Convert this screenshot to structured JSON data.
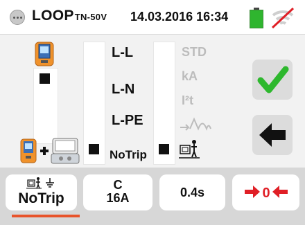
{
  "header": {
    "title": "LOOP",
    "title_sub": "TN-50V",
    "datetime": "14.03.2016 16:34",
    "battery_color": "#2fb52f",
    "wifi_disabled_color": "#e01f26"
  },
  "modes": {
    "items": [
      "L-L",
      "L-N",
      "L-PE",
      "NoTrip"
    ]
  },
  "options": {
    "items": [
      "STD",
      "kA",
      "I²t"
    ]
  },
  "colors": {
    "accent": "#e8542b",
    "ok_green": "#2eb82e",
    "arrow_red": "#e01f26"
  },
  "toolbar": {
    "protection_label": "NoTrip",
    "breaker_curve": "C",
    "breaker_rating": "16A",
    "trip_time": "0.4s",
    "zero_label": "0"
  },
  "icons": [
    "menu-icon",
    "battery-icon",
    "wifi-off-icon",
    "meter-icon",
    "meter-plus-adapter-icon",
    "curve-icon",
    "person-earth-icon",
    "check-icon",
    "back-arrow-icon",
    "zero-calibration-icon"
  ]
}
